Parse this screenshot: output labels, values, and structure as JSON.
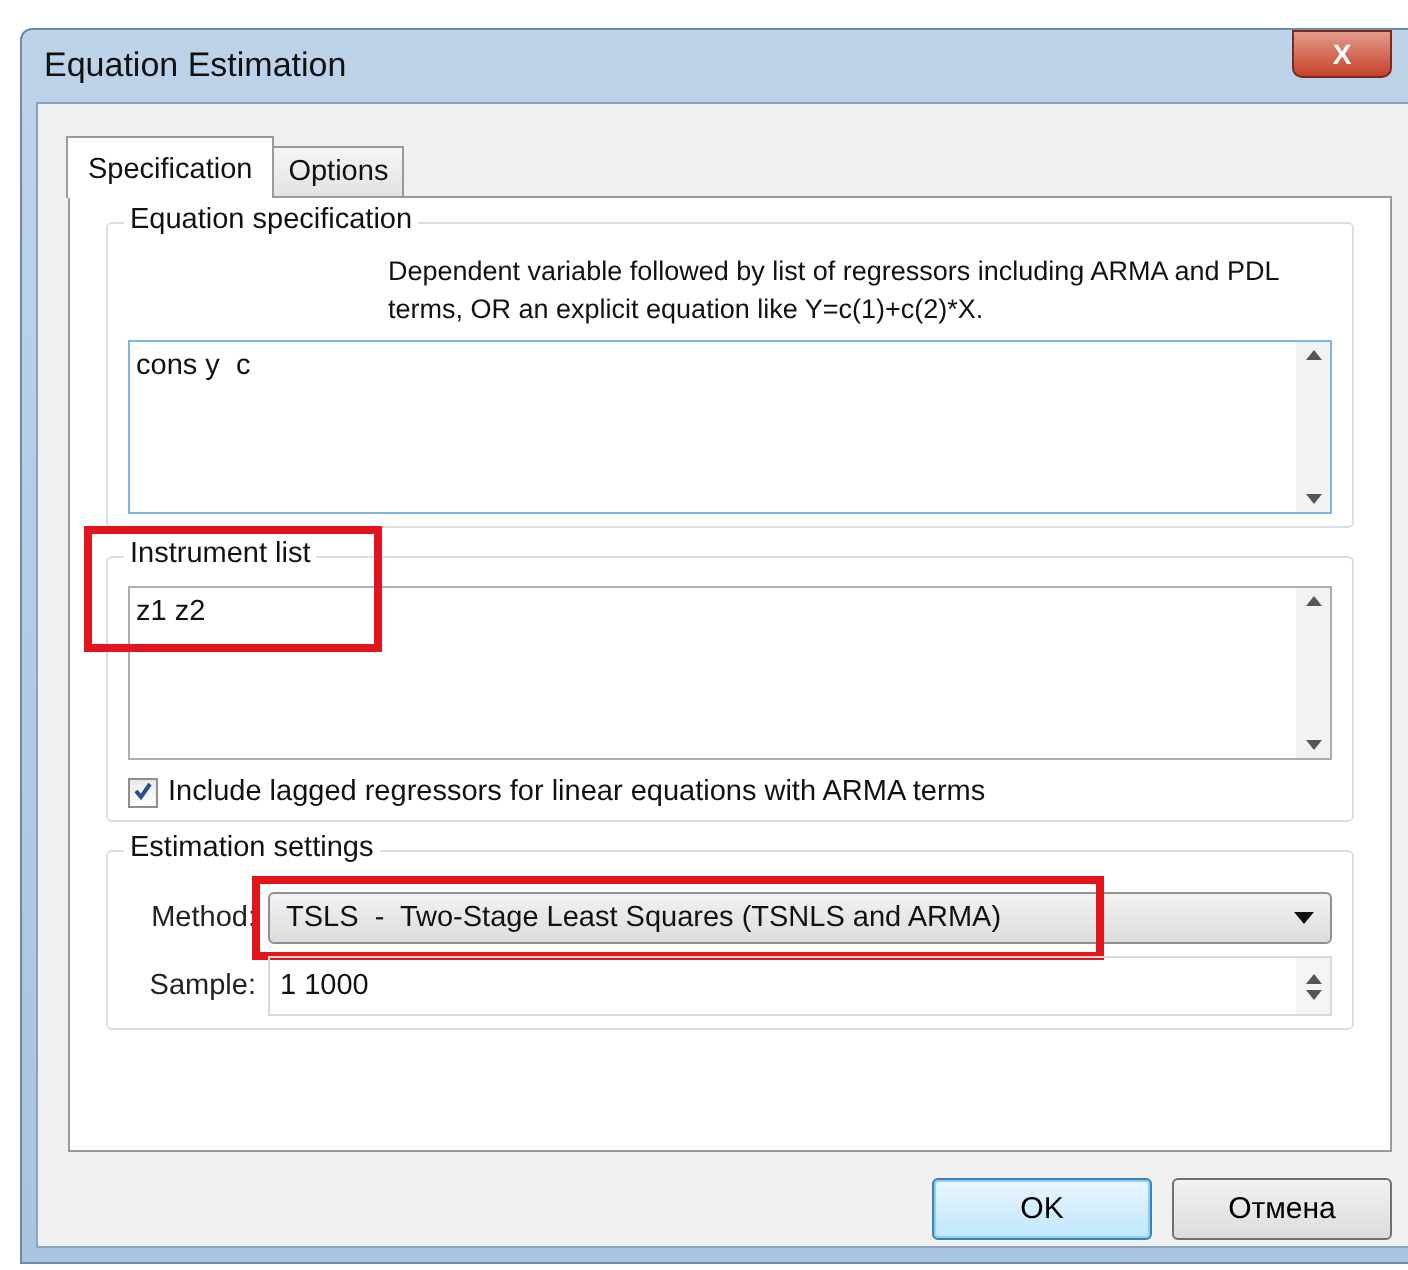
{
  "window": {
    "title": "Equation Estimation",
    "close_label": "X"
  },
  "tabs": [
    {
      "label": "Specification",
      "selected": true
    },
    {
      "label": "Options",
      "selected": false
    }
  ],
  "equation_specification": {
    "legend": "Equation specification",
    "hint": "Dependent variable followed by list of regressors including ARMA and PDL terms, OR an explicit equation like Y=c(1)+c(2)*X.",
    "value": "cons y  c"
  },
  "instrument_list": {
    "legend": "Instrument list",
    "value": "z1 z2",
    "highlighted": true,
    "checkbox": {
      "label": "Include lagged regressors for linear equations with ARMA terms",
      "checked": true
    }
  },
  "estimation_settings": {
    "legend": "Estimation settings",
    "method_label": "Method:",
    "method": "TSLS  -  Two-Stage Least Squares (TSNLS and ARMA)",
    "method_highlighted": true,
    "sample_label": "Sample:",
    "sample": "1 1000"
  },
  "buttons": [
    {
      "label": "OK",
      "default": true
    },
    {
      "label": "Отмена",
      "default": false
    }
  ]
}
